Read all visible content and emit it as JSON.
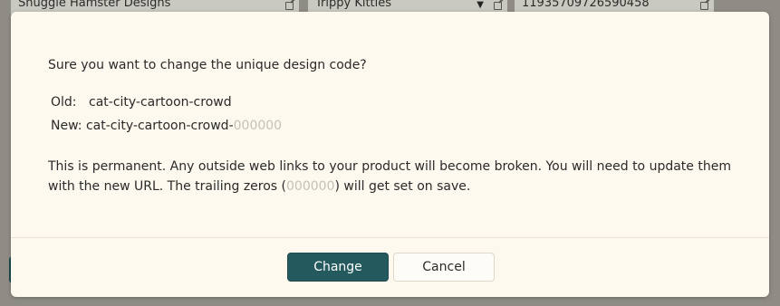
{
  "background": {
    "fields": [
      {
        "value": "Snuggle Hamster Designs"
      },
      {
        "value": "Trippy Kitties"
      },
      {
        "value": "1193570972659045​8"
      }
    ]
  },
  "dialog": {
    "question": "Sure you want to change the unique design code?",
    "old_label": "Old:",
    "old_value": "cat-city-cartoon-crowd",
    "new_label": "New:",
    "new_value": "cat-city-cartoon-crowd-",
    "new_suffix": "000000",
    "paragraph_part1": "This is permanent. Any outside web links to your product will become broken. You will need to update them with the new URL. The trailing zeros (",
    "paragraph_zeros": "000000",
    "paragraph_part2": ") will get set on save.",
    "change_label": "Change",
    "cancel_label": "Cancel"
  },
  "colors": {
    "overlay": "#8e8c84",
    "dialog_bg": "#fdf9ee",
    "primary": "#245a5e",
    "muted_zeros": "#c4c1b6"
  }
}
